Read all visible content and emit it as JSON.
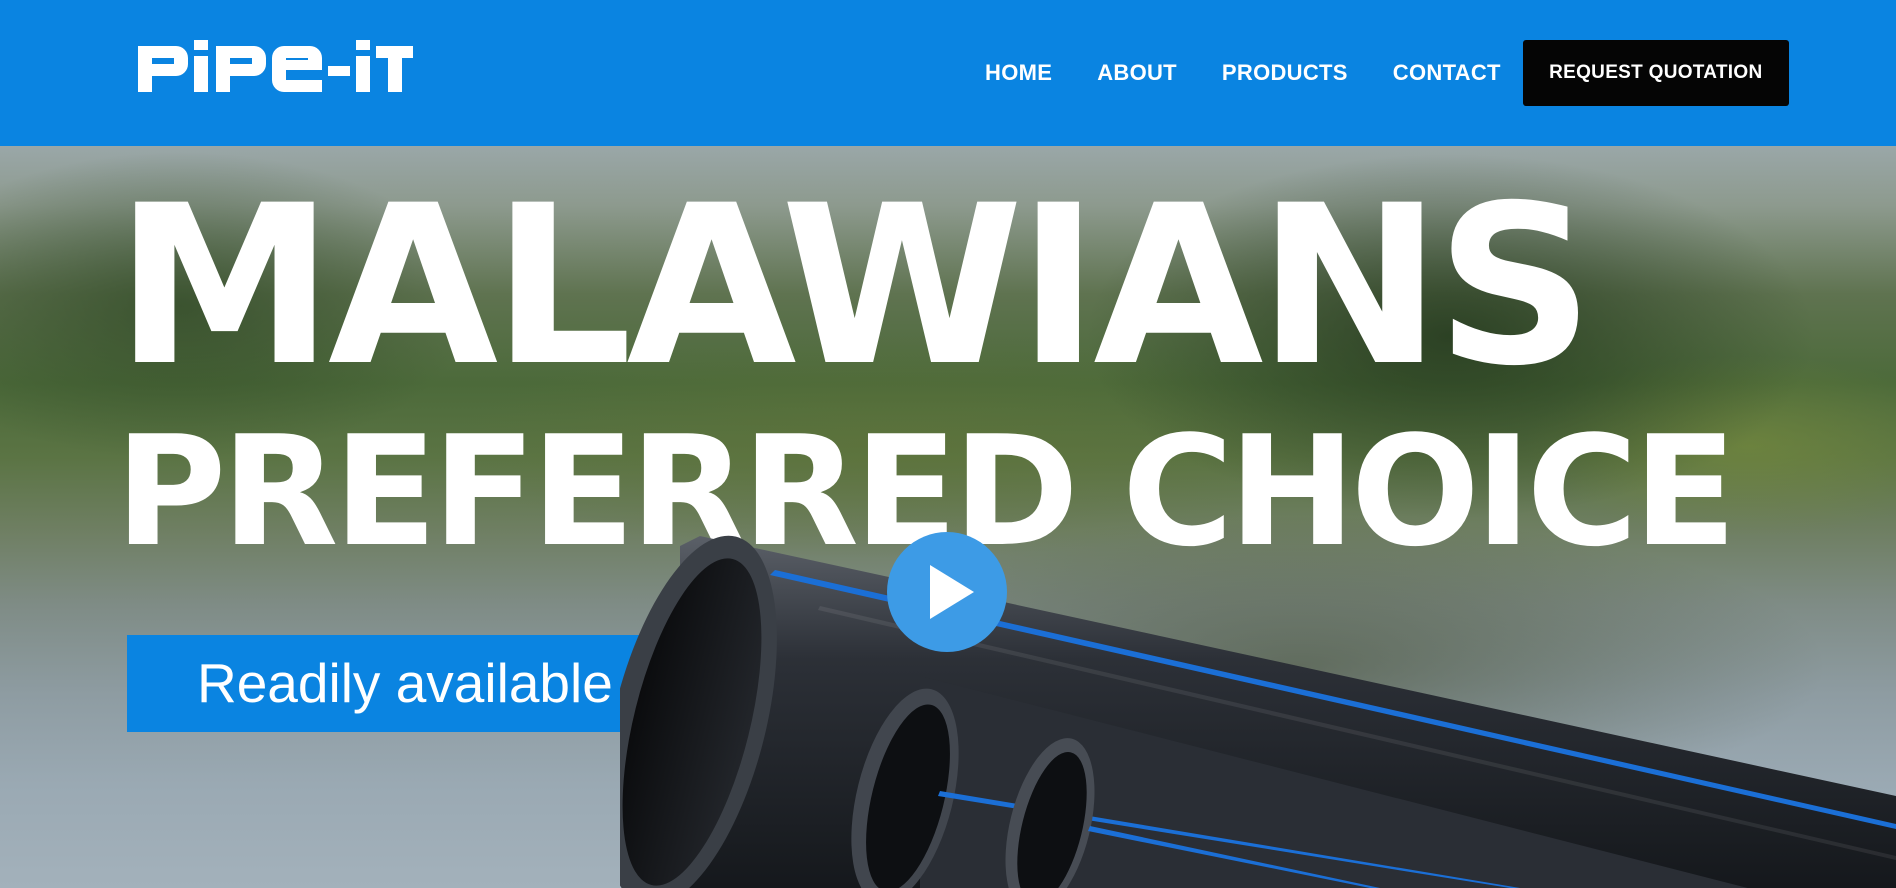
{
  "brand": {
    "logo_text": "PiPe-iT",
    "header_color": "#0a84e1",
    "accent_dark": "#050505"
  },
  "nav": {
    "items": [
      {
        "label": "HOME"
      },
      {
        "label": "ABOUT"
      },
      {
        "label": "PRODUCTS"
      },
      {
        "label": "CONTACT"
      }
    ],
    "cta_label": "REQUEST QUOTATION"
  },
  "hero": {
    "headline_line1": "MALAWIANS",
    "headline_line2": "PREFERRED CHOICE",
    "tagline": "Readily available",
    "play_icon": "play-icon",
    "play_button_color": "#3d9be6"
  }
}
